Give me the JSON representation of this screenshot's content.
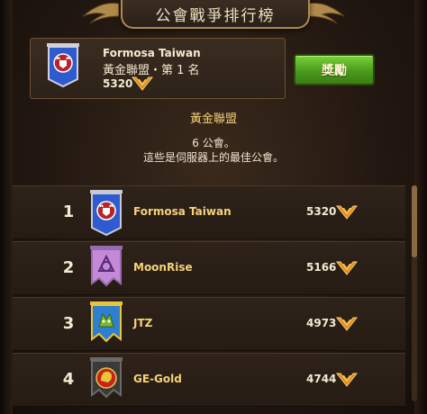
{
  "header": {
    "title": "公會戰爭排行榜"
  },
  "my_guild": {
    "name": "Formosa Taiwan",
    "rank_line": "黃金聯盟・第 1 名",
    "score": "5320",
    "banner_color": "#2f5bd0",
    "emblem": "bull-icon"
  },
  "reward_button": {
    "label": "獎勵"
  },
  "league": {
    "title": "黃金聯盟",
    "count": "6 公會。",
    "note": "這些是伺服器上的最佳公會。"
  },
  "colors": {
    "accent_gold": "#f5d27a",
    "button_green": "#5cb02a",
    "panel": "#2e2219"
  },
  "rows": [
    {
      "rank": "1",
      "name": "Formosa Taiwan",
      "score": "5320",
      "banner_color": "#2f5bd0",
      "banner_border": "#c9c9d6",
      "emblem": "bull-icon"
    },
    {
      "rank": "2",
      "name": "MoonRise",
      "score": "5166",
      "banner_color": "#c48ad8",
      "banner_border": "#9a6ab0",
      "emblem": "triquetra-icon"
    },
    {
      "rank": "3",
      "name": "JTZ",
      "score": "4973",
      "banner_color": "#2f7fd0",
      "banner_border": "#e8c53a",
      "emblem": "beast-icon"
    },
    {
      "rank": "4",
      "name": "GE-Gold",
      "score": "4744",
      "banner_color": "#3a3a3a",
      "banner_border": "#6a6a6a",
      "emblem": "lion-icon"
    }
  ]
}
